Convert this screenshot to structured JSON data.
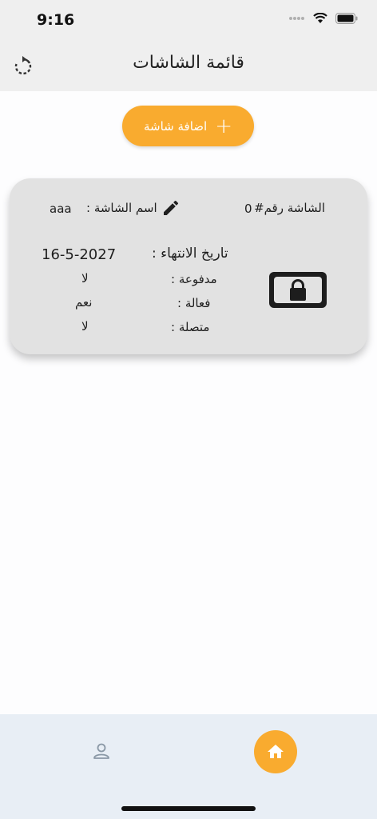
{
  "status_bar": {
    "time": "9:16"
  },
  "app_bar": {
    "title": "قائمة الشاشات",
    "refresh_icon": "refresh-icon"
  },
  "add_button": {
    "label": "اضافة شاشة",
    "icon": "plus-icon",
    "color": "#f9ab2f"
  },
  "screen_card": {
    "number_label": "الشاشة رقم#",
    "number_value": "0",
    "name_label": "اسم الشاشة :",
    "name_value": "aaa",
    "edit_icon": "pencil-icon",
    "fields": [
      {
        "label": "تاريخ الانتهاء :",
        "value": "16-5-2027"
      },
      {
        "label": "مدفوعة :",
        "value": "لا"
      },
      {
        "label": "فعالة :",
        "value": "نعم"
      },
      {
        "label": "متصلة :",
        "value": "لا"
      }
    ],
    "status_icon": "locked-screen-icon"
  },
  "bottom_nav": {
    "items": [
      {
        "name": "profile",
        "icon": "person-icon"
      },
      {
        "name": "home",
        "icon": "home-icon",
        "active": true
      }
    ]
  }
}
